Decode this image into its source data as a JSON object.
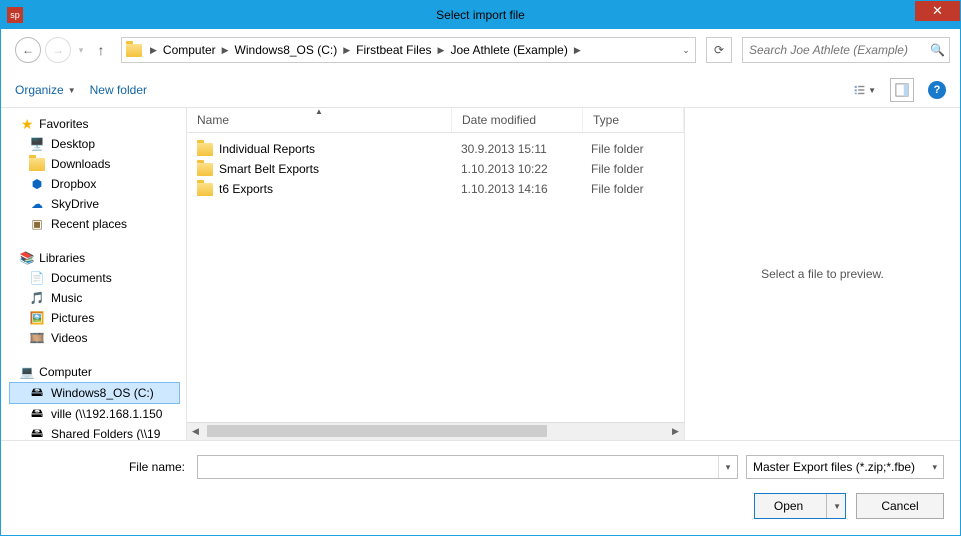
{
  "window": {
    "title": "Select import file"
  },
  "breadcrumb": {
    "items": [
      "Computer",
      "Windows8_OS (C:)",
      "Firstbeat Files",
      "Joe Athlete (Example)"
    ]
  },
  "search": {
    "placeholder": "Search Joe Athlete (Example)"
  },
  "toolbar": {
    "organize": "Organize",
    "newfolder": "New folder"
  },
  "sidebar": {
    "favorites": {
      "label": "Favorites",
      "items": [
        "Desktop",
        "Downloads",
        "Dropbox",
        "SkyDrive",
        "Recent places"
      ]
    },
    "libraries": {
      "label": "Libraries",
      "items": [
        "Documents",
        "Music",
        "Pictures",
        "Videos"
      ]
    },
    "computer": {
      "label": "Computer",
      "items": [
        "Windows8_OS (C:)",
        "ville (\\\\192.168.1.150",
        "Shared Folders (\\\\19"
      ]
    }
  },
  "columns": {
    "name": "Name",
    "date": "Date modified",
    "type": "Type"
  },
  "files": [
    {
      "name": "Individual Reports",
      "date": "30.9.2013 15:11",
      "type": "File folder"
    },
    {
      "name": "Smart Belt Exports",
      "date": "1.10.2013 10:22",
      "type": "File folder"
    },
    {
      "name": "t6 Exports",
      "date": "1.10.2013 14:16",
      "type": "File folder"
    }
  ],
  "preview": {
    "text": "Select a file to preview."
  },
  "bottom": {
    "filename_label": "File name:",
    "filter": "Master Export files (*.zip;*.fbe)",
    "open": "Open",
    "cancel": "Cancel"
  }
}
